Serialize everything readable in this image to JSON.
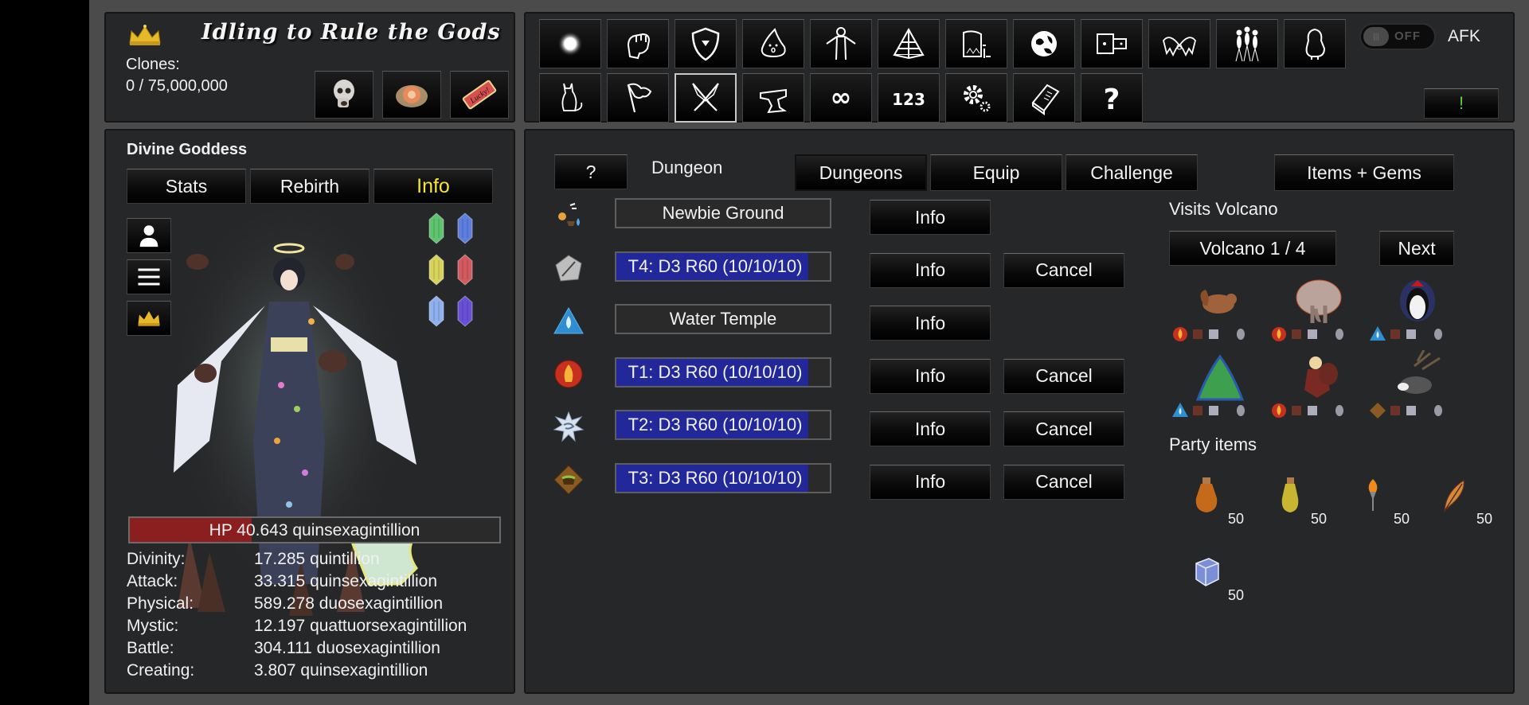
{
  "header": {
    "title": "Idling to Rule the Gods",
    "clones_label": "Clones:",
    "clones_value": "0 / 75,000,000",
    "quick_buttons": [
      {
        "icon": "skull-icon"
      },
      {
        "icon": "flame-orb-icon"
      },
      {
        "icon": "lucky-ticket-icon",
        "text": "Lucky!"
      }
    ]
  },
  "toolbar": {
    "row1": [
      "light-orb-icon",
      "fist-icon",
      "shield-icon",
      "slime-icon",
      "human-figure-icon",
      "pyramid-icon",
      "factory-icon",
      "planet-icon",
      "spaceship-icon",
      "demon-wings-icon",
      "people-icon",
      "penguin-icon"
    ],
    "row2": [
      "cat-icon",
      "flag-icon",
      "crossed-swords-icon",
      "anvil-icon",
      "infinity-icon",
      "numbers-icon",
      "settings-gears-icon",
      "book-icon",
      "help-icon"
    ],
    "row2_labels": {
      "infinity": "∞",
      "numbers": "123",
      "help": "?"
    },
    "selected": "crossed-swords-icon",
    "afk_toggle": {
      "state": "OFF",
      "label": "AFK"
    },
    "alert_button": "!"
  },
  "character": {
    "name": "Divine Goddess",
    "tabs": [
      "Stats",
      "Rebirth",
      "Info"
    ],
    "active_tab": "Info",
    "side_buttons": [
      "person-icon",
      "menu-icon",
      "crown-icon"
    ],
    "crystals": [
      "green",
      "blue",
      "yellow",
      "red",
      "light-blue",
      "purple"
    ],
    "hp": {
      "text": "HP 40.643 quinsexagintillion",
      "fraction": 0.33
    },
    "stats": [
      {
        "label": "Divinity:",
        "value": "17.285 quintillion"
      },
      {
        "label": "Attack:",
        "value": "33.315 quinsexagintillion"
      },
      {
        "label": "Physical:",
        "value": "589.278 duosexagintillion"
      },
      {
        "label": "Mystic:",
        "value": "12.197 quattuorsexagintillion"
      },
      {
        "label": "Battle:",
        "value": "304.111 duosexagintillion"
      },
      {
        "label": "Creating:",
        "value": "3.807 quinsexagintillion"
      }
    ]
  },
  "dungeon": {
    "help_label": "?",
    "title": "Dungeon",
    "tabs": [
      "Dungeons",
      "Equip",
      "Challenge"
    ],
    "active_tab": "Dungeons",
    "items_gems": "Items + Gems",
    "info_label": "Info",
    "cancel_label": "Cancel",
    "rows": [
      {
        "icon": "newbie-ground-icon",
        "name": "Newbie Ground",
        "progress": null,
        "cancel": false
      },
      {
        "icon": "neutral-pentagon-icon",
        "name": "T4: D3 R60 (10/10/10)",
        "progress": 0.9,
        "cancel": true
      },
      {
        "icon": "water-element-icon",
        "name": "Water Temple",
        "progress": null,
        "cancel": false
      },
      {
        "icon": "fire-element-icon",
        "name": "T1: D3 R60 (10/10/10)",
        "progress": 0.9,
        "cancel": true
      },
      {
        "icon": "wind-element-icon",
        "name": "T2: D3 R60 (10/10/10)",
        "progress": 0.9,
        "cancel": true
      },
      {
        "icon": "earth-element-icon",
        "name": "T3: D3 R60 (10/10/10)",
        "progress": 0.9,
        "cancel": true
      }
    ],
    "visits_label": "Visits Volcano",
    "volcano_button": "Volcano 1 / 4",
    "next_button": "Next",
    "party": [
      {
        "pet": "squirrel",
        "element": "fire"
      },
      {
        "pet": "elephant",
        "element": "fire"
      },
      {
        "pet": "penguin",
        "element": "water"
      },
      {
        "pet": "slime-tree",
        "element": "water"
      },
      {
        "pet": "girl",
        "element": "fire"
      },
      {
        "pet": "rabbit",
        "element": "earth"
      }
    ],
    "party_items_label": "Party items",
    "party_items": [
      {
        "icon": "orange-potion-icon",
        "count": "50"
      },
      {
        "icon": "yellow-potion-icon",
        "count": "50"
      },
      {
        "icon": "torch-icon",
        "count": "50"
      },
      {
        "icon": "feather-icon",
        "count": "50"
      },
      {
        "icon": "ice-cube-icon",
        "count": "50"
      }
    ]
  },
  "colors": {
    "frame": "#4b4b4b",
    "panel": "#262729",
    "active_tab_text": "#f4e53a",
    "hp_fill": "#8b1f1f",
    "progress_fill": "#22279a",
    "alert": "#5bd13a"
  }
}
